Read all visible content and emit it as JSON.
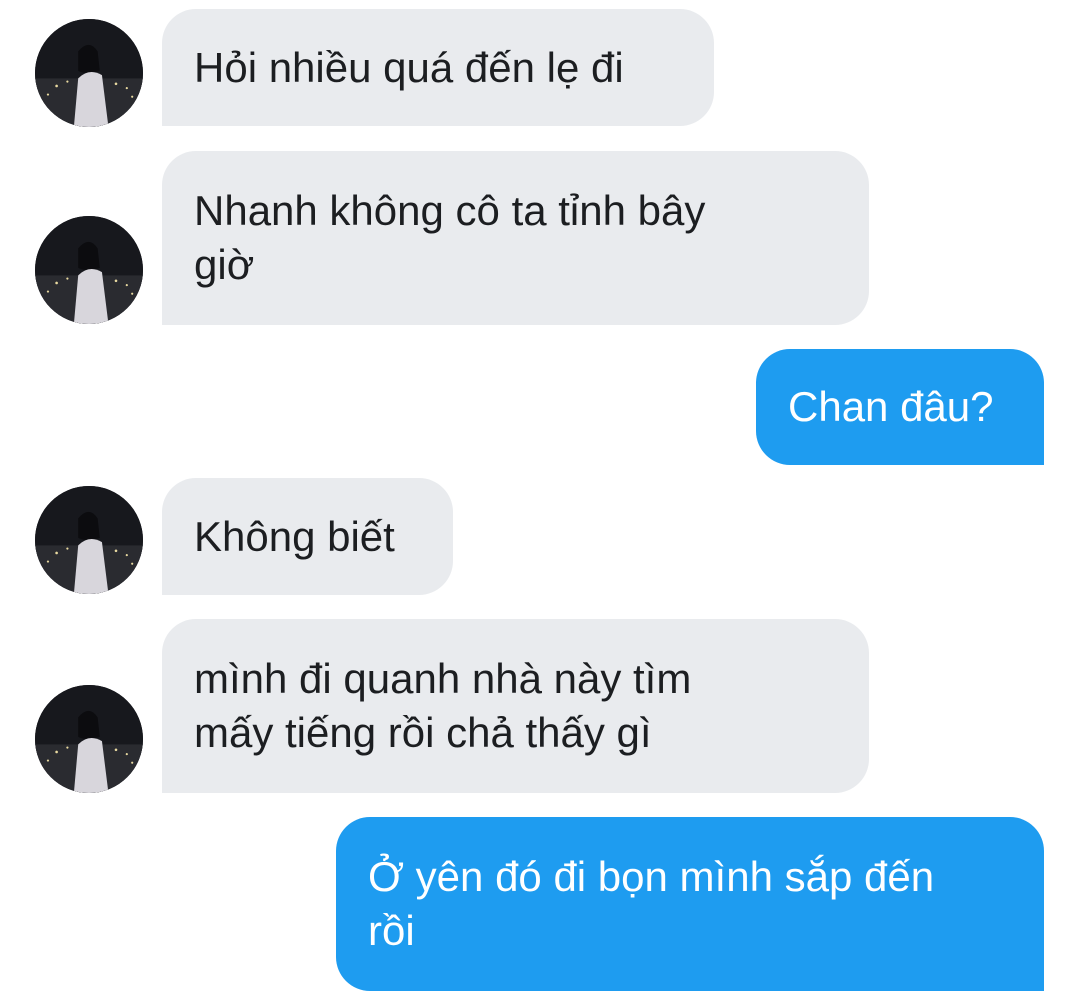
{
  "chat": {
    "messages": [
      {
        "direction": "received",
        "text": "Hỏi nhiều quá đến lẹ đi"
      },
      {
        "direction": "received",
        "text": "Nhanh không cô ta tỉnh bây\ngiờ"
      },
      {
        "direction": "sent",
        "text": "Chan đâu?"
      },
      {
        "direction": "received",
        "text": "Không biết"
      },
      {
        "direction": "received",
        "text": "mình đi quanh nhà này tìm\nmấy tiếng rồi chả thấy gì"
      },
      {
        "direction": "sent",
        "text": "Ở yên đó đi bọn mình sắp đến\nrồi"
      }
    ]
  },
  "colors": {
    "received_bubble": "#e9ebee",
    "sent_bubble": "#1e9cf0",
    "received_text": "#1c1e21",
    "sent_text": "#ffffff"
  },
  "icons": {
    "avatar": "contact-avatar-photo"
  }
}
